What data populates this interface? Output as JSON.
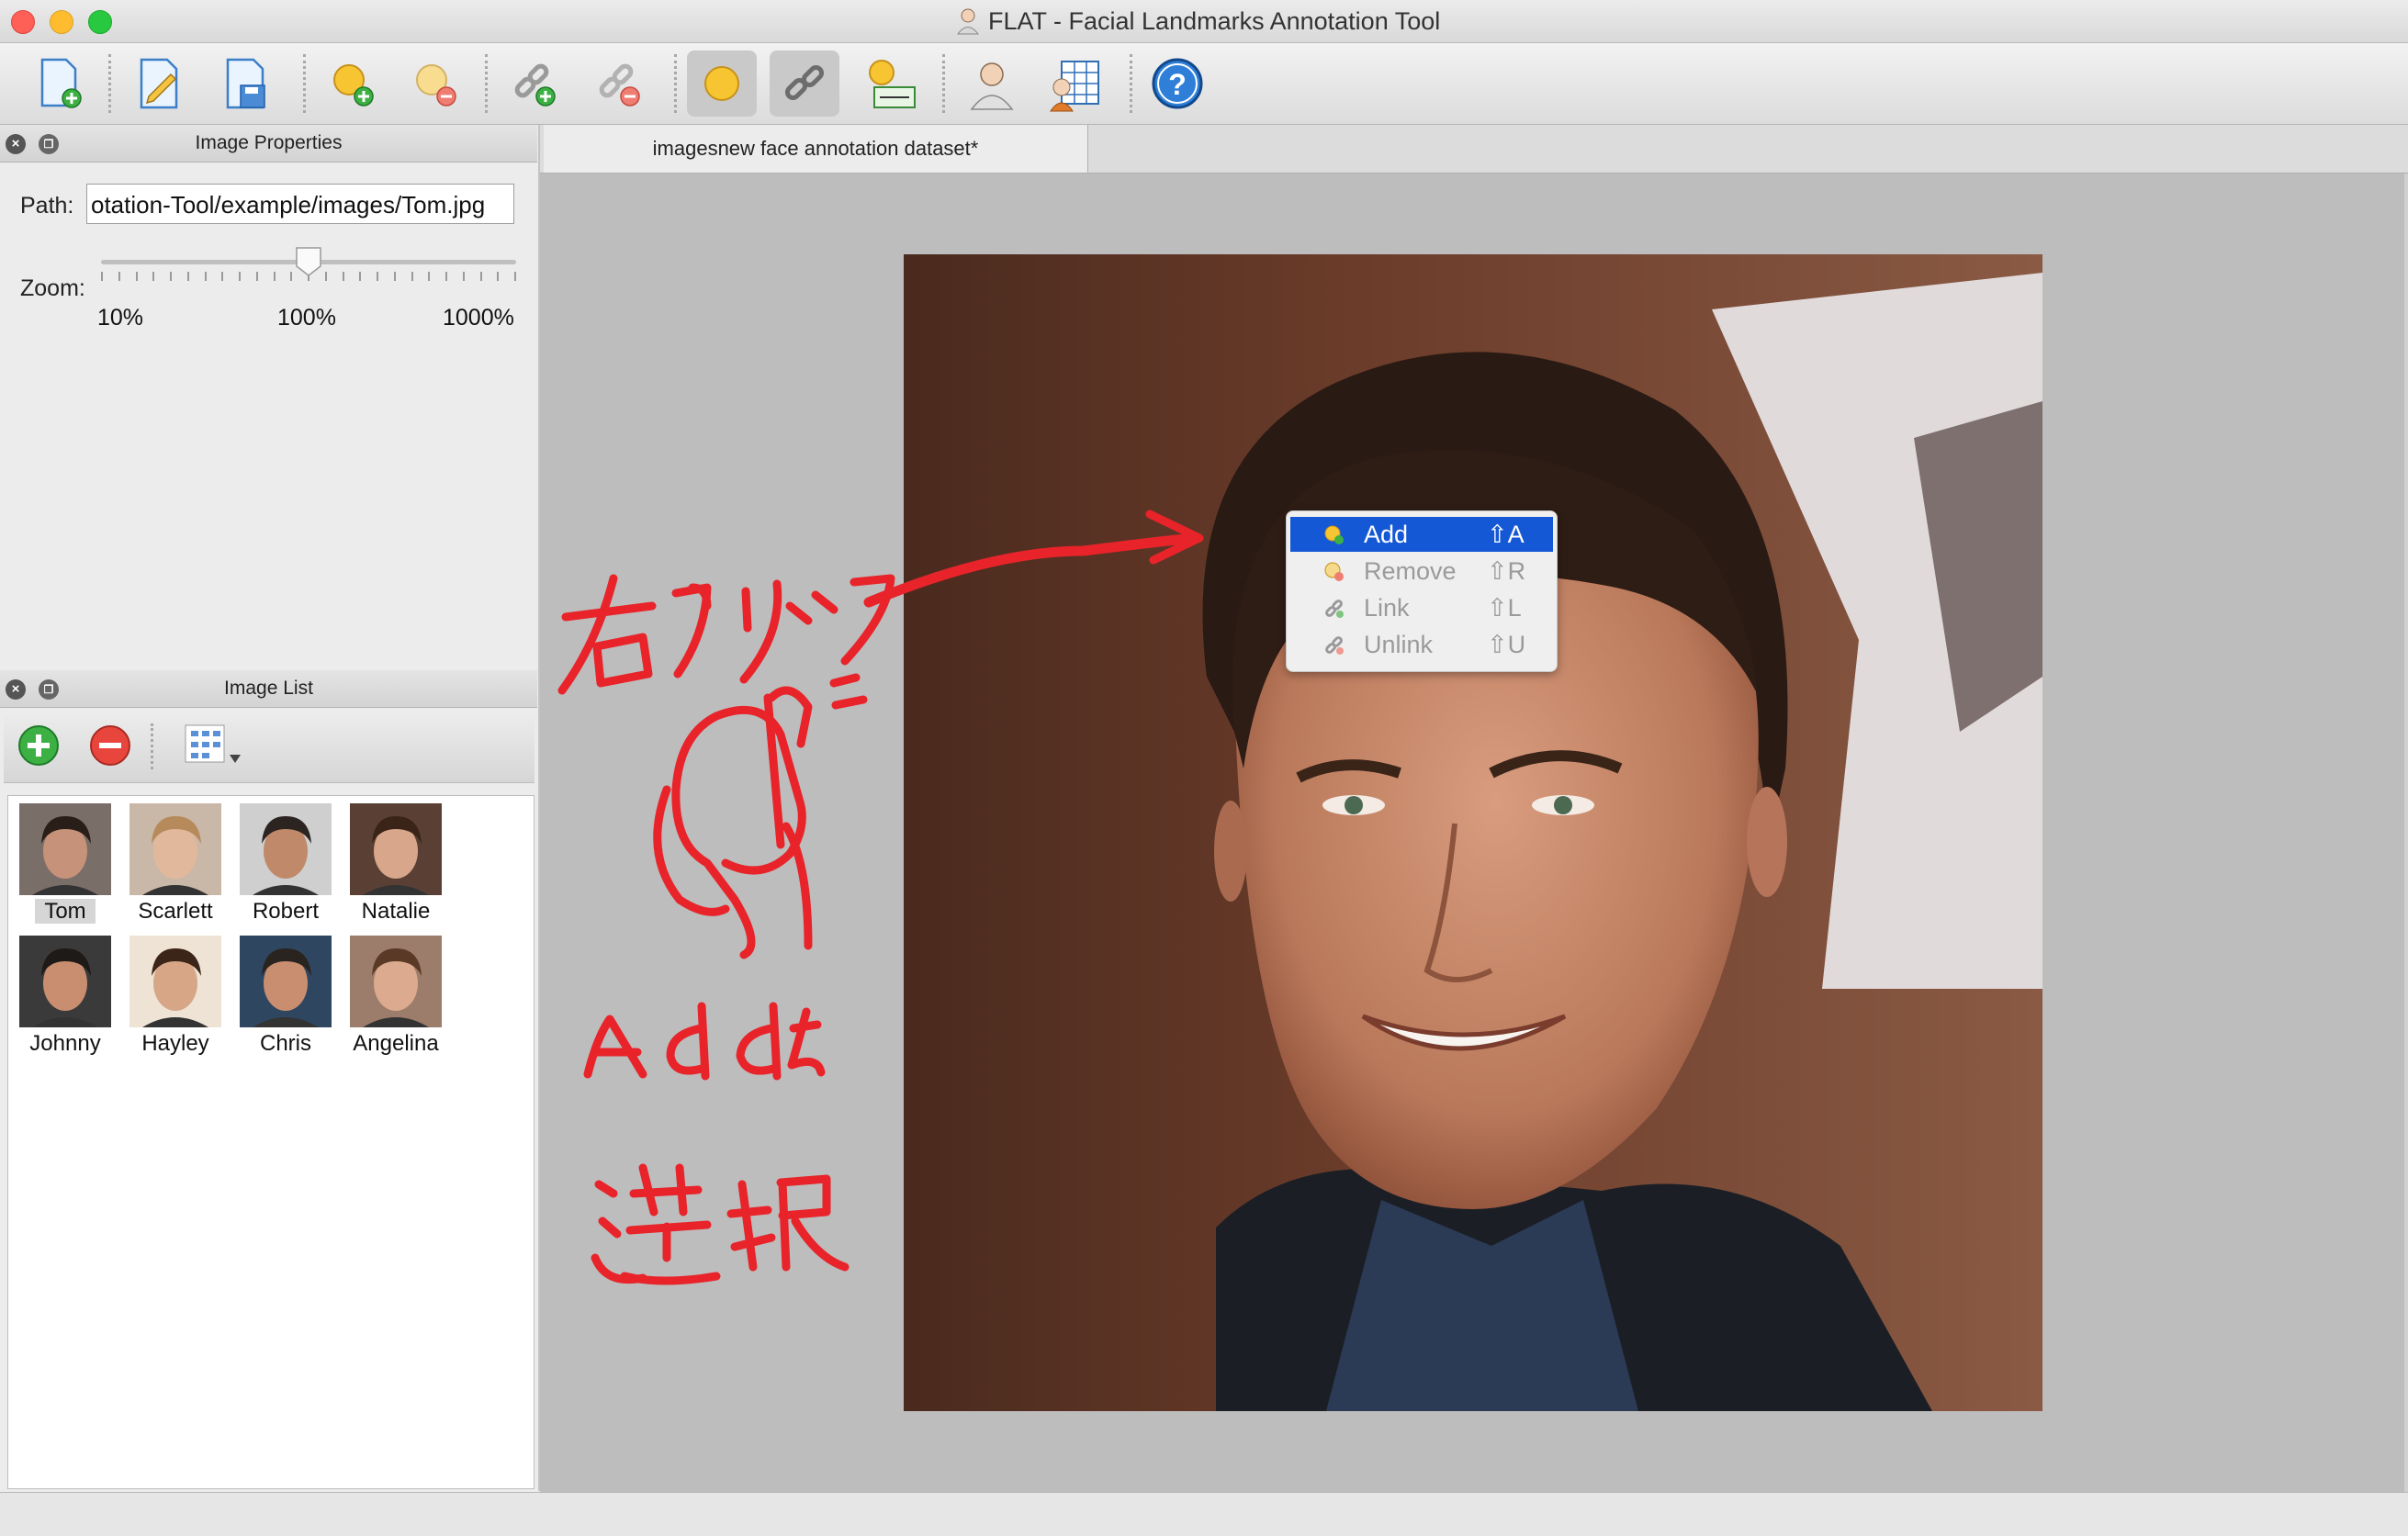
{
  "window": {
    "title": "FLAT - Facial Landmarks Annotation Tool"
  },
  "toolbar": {
    "buttons": [
      {
        "icon": "new-file-icon",
        "label": "New"
      },
      {
        "icon": "edit-file-icon",
        "label": "Edit"
      },
      {
        "icon": "save-file-icon",
        "label": "Save"
      },
      {
        "icon": "add-landmark-icon",
        "label": "Add landmark"
      },
      {
        "icon": "remove-landmark-icon",
        "label": "Remove landmark"
      },
      {
        "icon": "add-link-icon",
        "label": "Add link"
      },
      {
        "icon": "remove-link-icon",
        "label": "Remove link"
      },
      {
        "icon": "show-landmarks-icon",
        "label": "Show landmarks"
      },
      {
        "icon": "show-links-icon",
        "label": "Show links"
      },
      {
        "icon": "landmark-ids-icon",
        "label": "Show landmark IDs"
      },
      {
        "icon": "face-fit-icon",
        "label": "Fit landmarks"
      },
      {
        "icon": "properties-table-icon",
        "label": "Properties"
      },
      {
        "icon": "help-icon",
        "label": "Help"
      }
    ]
  },
  "image_properties": {
    "title": "Image Properties",
    "path_label": "Path:",
    "path_value": "otation-Tool/example/images/Tom.jpg",
    "zoom_label": "Zoom:",
    "zoom_ticks": [
      "10%",
      "100%",
      "1000%"
    ],
    "zoom_value_percent": 100
  },
  "image_list": {
    "title": "Image List",
    "add_icon": "add-image-icon",
    "remove_icon": "remove-image-icon",
    "view_icon": "view-mode-icon",
    "items": [
      {
        "name": "Tom",
        "selected": true
      },
      {
        "name": "Scarlett",
        "selected": false
      },
      {
        "name": "Robert",
        "selected": false
      },
      {
        "name": "Natalie",
        "selected": false
      },
      {
        "name": "Johnny",
        "selected": false
      },
      {
        "name": "Hayley",
        "selected": false
      },
      {
        "name": "Chris",
        "selected": false
      },
      {
        "name": "Angelina",
        "selected": false
      }
    ]
  },
  "editor": {
    "tab_label": "imagesnew face annotation dataset*"
  },
  "context_menu": {
    "items": [
      {
        "label": "Add",
        "shortcut": "⇧A",
        "icon": "add-landmark-icon",
        "highlighted": true
      },
      {
        "label": "Remove",
        "shortcut": "⇧R",
        "icon": "remove-landmark-icon",
        "highlighted": false
      },
      {
        "label": "Link",
        "shortcut": "⇧L",
        "icon": "link-icon",
        "highlighted": false
      },
      {
        "label": "Unlink",
        "shortcut": "⇧U",
        "icon": "unlink-icon",
        "highlighted": false
      }
    ]
  },
  "colors": {
    "menu_highlight": "#1558d6",
    "annotation_red": "#e8242a",
    "canvas_bg": "#bdbdbd"
  }
}
